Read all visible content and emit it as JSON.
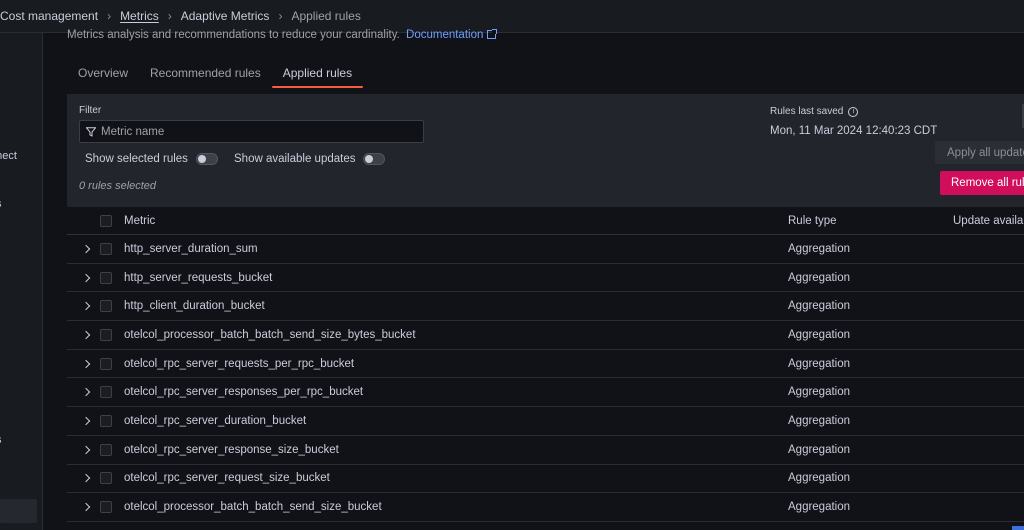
{
  "sidebar": {
    "fragments": [
      "nnect",
      "s",
      "s"
    ]
  },
  "breadcrumb": {
    "items": [
      "Cost management",
      "Metrics",
      "Adaptive Metrics",
      "Applied rules"
    ]
  },
  "subtitle": {
    "text": "Metrics analysis and recommendations to reduce your cardinality.",
    "link": "Documentation"
  },
  "tabs": [
    {
      "label": "Overview",
      "active": false
    },
    {
      "label": "Recommended rules",
      "active": false
    },
    {
      "label": "Applied rules",
      "active": true
    }
  ],
  "filter": {
    "label": "Filter",
    "placeholder": "Metric name",
    "show_selected": "Show selected rules",
    "show_updates": "Show available updates",
    "selected_count": "0 rules selected"
  },
  "saved": {
    "label": "Rules last saved",
    "value": "Mon, 11 Mar 2024 12:40:23 CDT"
  },
  "actions": {
    "apply_all": "Apply all updates",
    "remove_all": "Remove all rules"
  },
  "table": {
    "headers": {
      "metric": "Metric",
      "rule_type": "Rule type",
      "update": "Update available"
    },
    "rows": [
      {
        "metric": "http_server_duration_sum",
        "rule_type": "Aggregation"
      },
      {
        "metric": "http_server_requests_bucket",
        "rule_type": "Aggregation"
      },
      {
        "metric": "http_client_duration_bucket",
        "rule_type": "Aggregation"
      },
      {
        "metric": "otelcol_processor_batch_batch_send_size_bytes_bucket",
        "rule_type": "Aggregation"
      },
      {
        "metric": "otelcol_rpc_server_requests_per_rpc_bucket",
        "rule_type": "Aggregation"
      },
      {
        "metric": "otelcol_rpc_server_responses_per_rpc_bucket",
        "rule_type": "Aggregation"
      },
      {
        "metric": "otelcol_rpc_server_duration_bucket",
        "rule_type": "Aggregation"
      },
      {
        "metric": "otelcol_rpc_server_response_size_bucket",
        "rule_type": "Aggregation"
      },
      {
        "metric": "otelcol_rpc_server_request_size_bucket",
        "rule_type": "Aggregation"
      },
      {
        "metric": "otelcol_processor_batch_batch_send_size_bucket",
        "rule_type": "Aggregation"
      }
    ]
  },
  "colors": {
    "background": "#111217",
    "panel": "#22252b",
    "accent_tab": "#f55f3e",
    "danger_button": "#d10e5c",
    "link": "#6e9fff"
  }
}
